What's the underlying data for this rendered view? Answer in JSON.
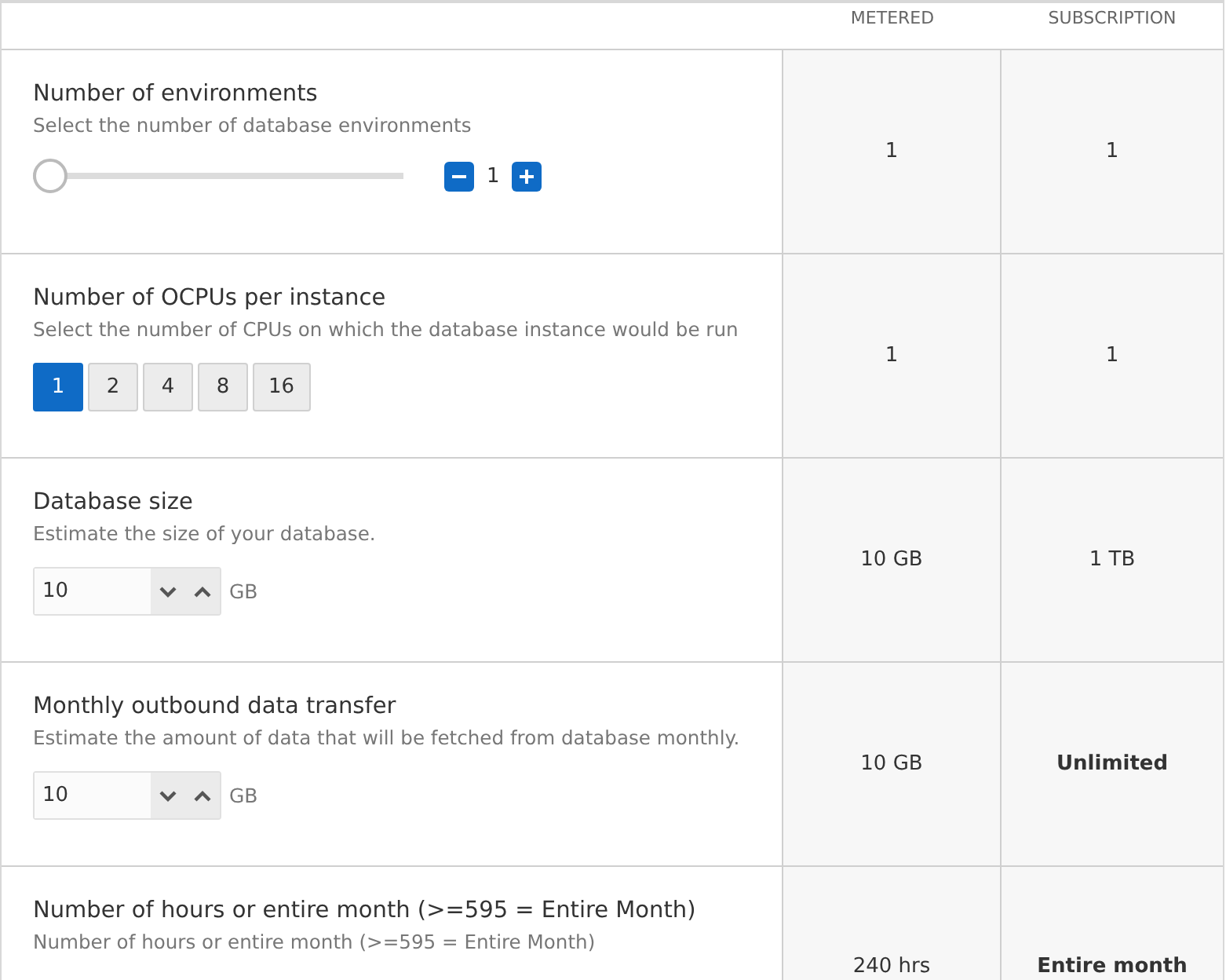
{
  "columns": [
    "METERED",
    "SUBSCRIPTION"
  ],
  "rows": [
    {
      "kind": "slider",
      "title": "Number of environments",
      "description": "Select the number of database environments",
      "level": 0,
      "count": "1",
      "metered": {
        "text": "1",
        "bold": false
      },
      "subscription": {
        "text": "1",
        "bold": false
      }
    },
    {
      "kind": "segmented",
      "title": "Number of OCPUs per instance",
      "description": "Select the number of CPUs on which the database instance would be run",
      "options": [
        {
          "label": "1",
          "selected": true
        },
        {
          "label": "2",
          "selected": false
        },
        {
          "label": "4",
          "selected": false
        },
        {
          "label": "8",
          "selected": false
        },
        {
          "label": "16",
          "selected": false
        }
      ],
      "metered": {
        "text": "1",
        "bold": false
      },
      "subscription": {
        "text": "1",
        "bold": false
      }
    },
    {
      "kind": "spinner",
      "title": "Database size",
      "description": "Estimate the size of your database.",
      "value": "10",
      "unit": "GB",
      "metered": {
        "text": "10 GB",
        "bold": false
      },
      "subscription": {
        "text": "1 TB",
        "bold": false
      }
    },
    {
      "kind": "spinner",
      "title": "Monthly outbound data transfer",
      "description": "Estimate the amount of data that will be fetched from database monthly.",
      "value": "10",
      "unit": "GB",
      "metered": {
        "text": "10 GB",
        "bold": false
      },
      "subscription": {
        "text": "Unlimited",
        "bold": true
      }
    },
    {
      "kind": "text",
      "title": "Number of hours or entire month (>=595 = Entire Month)",
      "description": "Number of hours or entire month (>=595 = Entire Month)",
      "metered": {
        "text": "240 hrs",
        "bold": false
      },
      "subscription": {
        "text": "Entire month",
        "bold": true
      }
    }
  ]
}
